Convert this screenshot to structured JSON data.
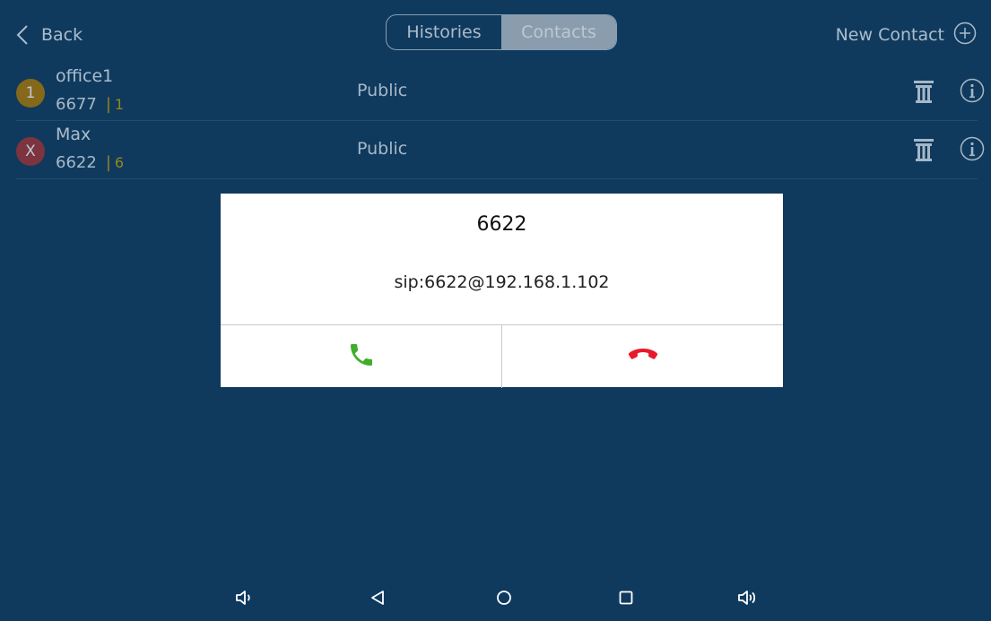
{
  "header": {
    "back_label": "Back",
    "tabs": [
      {
        "label": "Histories",
        "active": false
      },
      {
        "label": "Contacts",
        "active": true
      }
    ],
    "new_contact_label": "New Contact"
  },
  "contacts": [
    {
      "avatar_text": "1",
      "avatar_color": "#b37a00",
      "name": "office1",
      "number": "6677",
      "separator": "|",
      "count": "1",
      "group": "Public"
    },
    {
      "avatar_text": "X",
      "avatar_color": "#a83232",
      "name": "Max",
      "number": "6622",
      "separator": "|",
      "count": "6",
      "group": "Public"
    }
  ],
  "modal": {
    "title": "6622",
    "sip_uri": "sip:6622@192.168.1.102",
    "accept_icon": "phone-call-icon",
    "hangup_icon": "phone-hangup-icon",
    "accept_color": "#3fae2a",
    "hangup_color": "#e8192c"
  },
  "navbar": {
    "icons": [
      "volume-down-icon",
      "back-triangle-icon",
      "home-circle-icon",
      "recents-square-icon",
      "volume-up-icon"
    ]
  },
  "colors": {
    "background": "#0f3a5e",
    "active_tab": "#b8c3cd",
    "count_accent": "#c9a400"
  }
}
